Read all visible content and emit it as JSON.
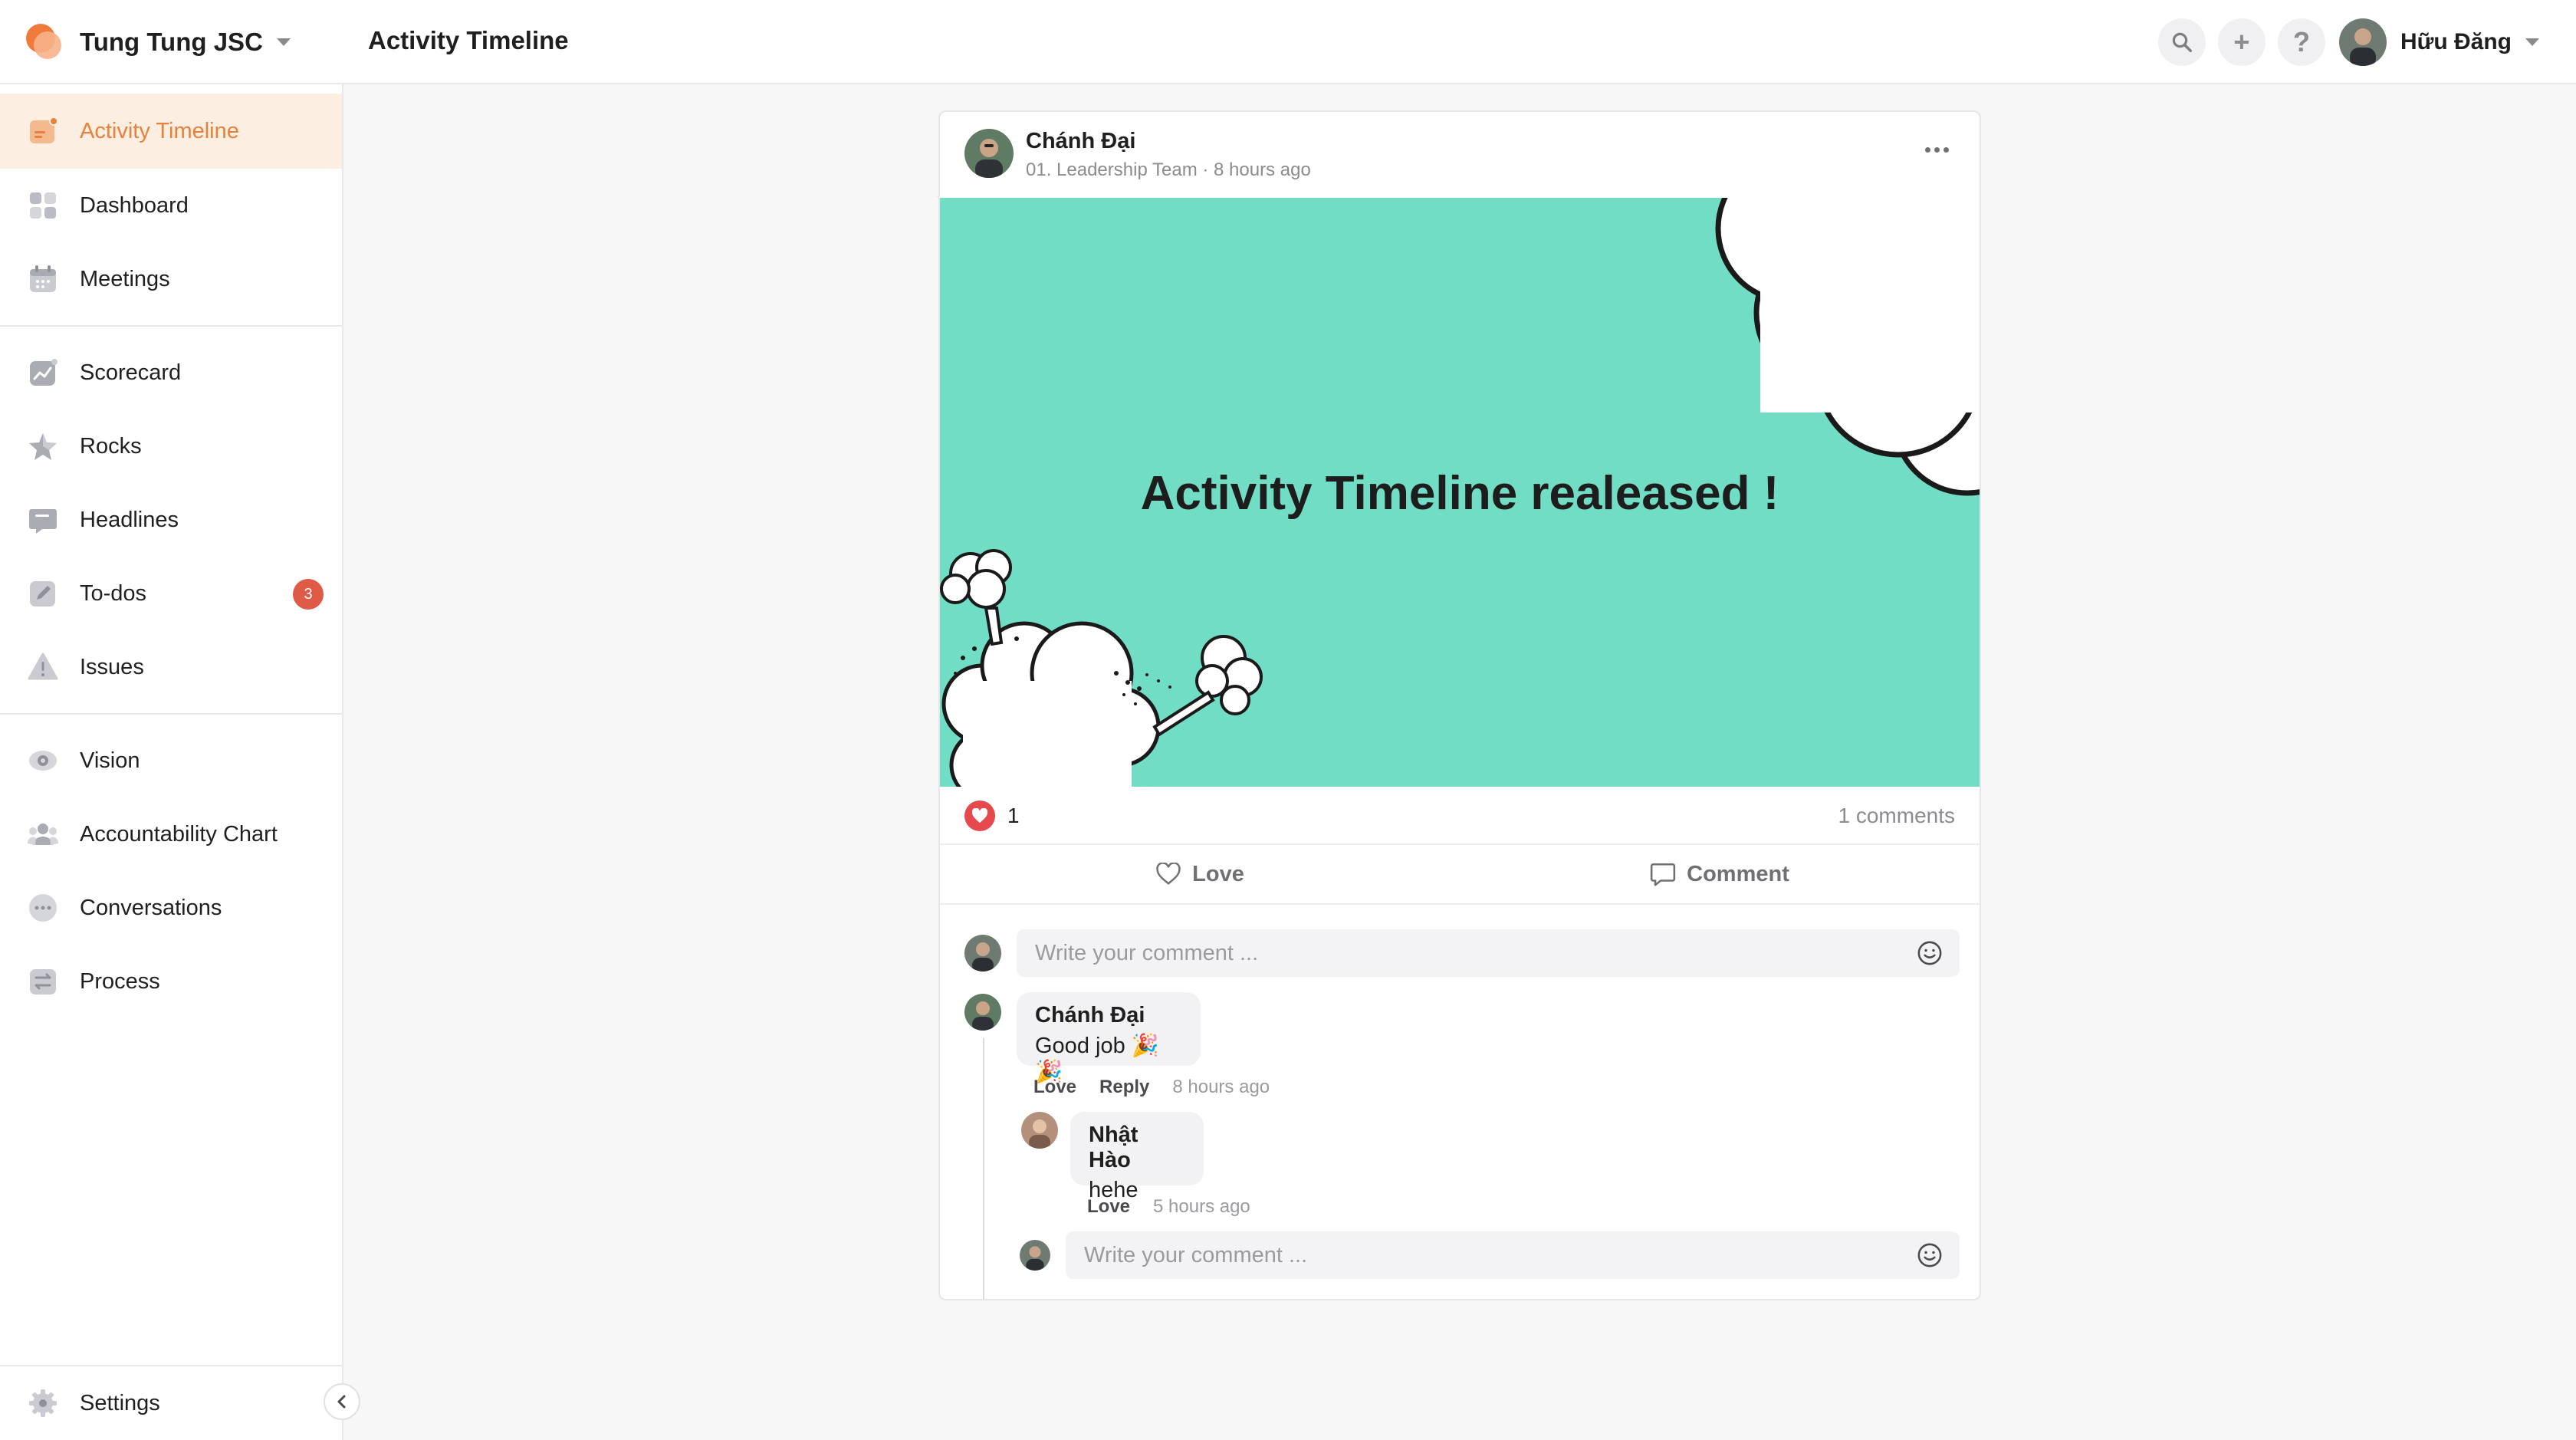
{
  "app": {
    "company": "Tung Tung JSC",
    "page_title": "Activity Timeline",
    "user_name": "Hữu Đăng"
  },
  "topbar": {
    "icons": [
      "search-icon",
      "plus-icon",
      "help-icon"
    ],
    "help_label": "?",
    "plus_label": "+"
  },
  "sidebar": {
    "groups": [
      [
        {
          "label": "Activity Timeline",
          "icon": "timeline-icon",
          "active": true
        },
        {
          "label": "Dashboard",
          "icon": "dashboard-icon"
        },
        {
          "label": "Meetings",
          "icon": "calendar-icon"
        }
      ],
      [
        {
          "label": "Scorecard",
          "icon": "scorecard-icon"
        },
        {
          "label": "Rocks",
          "icon": "star-icon"
        },
        {
          "label": "Headlines",
          "icon": "headline-icon"
        },
        {
          "label": "To-dos",
          "icon": "pencil-icon",
          "badge": "3"
        },
        {
          "label": "Issues",
          "icon": "warning-icon"
        }
      ],
      [
        {
          "label": "Vision",
          "icon": "eye-icon"
        },
        {
          "label": "Accountability Chart",
          "icon": "people-icon"
        },
        {
          "label": "Conversations",
          "icon": "chat-icon"
        },
        {
          "label": "Process",
          "icon": "process-icon"
        }
      ]
    ],
    "settings_label": "Settings",
    "accent": "#e8813c",
    "badge_color": "#e05a48"
  },
  "post": {
    "author": "Chánh Đại",
    "meta": "01. Leadership Team · 8 hours ago",
    "image_text": "Activity Timeline realeased !",
    "image_bg": "#71ddc5",
    "love_count": "1",
    "comment_count": "1 comments",
    "love_label": "Love",
    "comment_label": "Comment",
    "input_placeholder": "Write your comment ...",
    "comments": [
      {
        "author": "Chánh Đại",
        "text": "Good job 🎉🎉",
        "love": "Love",
        "reply": "Reply",
        "time": "8 hours ago"
      }
    ],
    "replies": [
      {
        "author": "Nhật Hào",
        "text": "hehe",
        "love": "Love",
        "time": "5 hours ago"
      }
    ],
    "reply_placeholder": "Write your comment ..."
  }
}
